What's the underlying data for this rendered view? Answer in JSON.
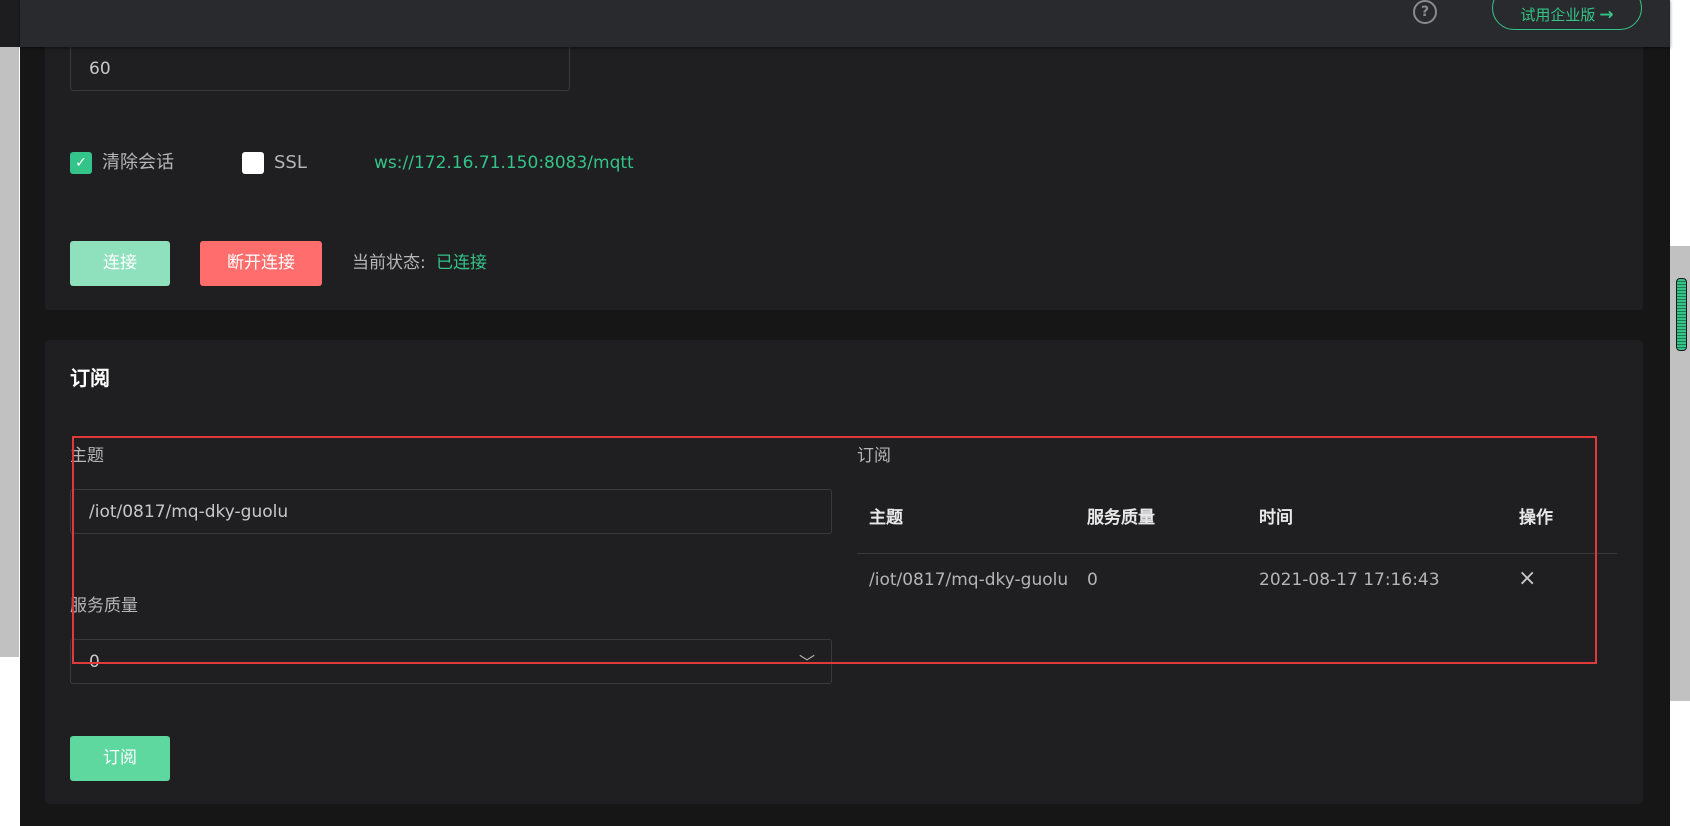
{
  "topbar": {
    "help_icon_glyph": "?",
    "trial_button_label": "试用企业版",
    "trial_button_arrow": "→"
  },
  "connection": {
    "keepalive_value": "60",
    "clean_session_label": "清除会话",
    "clean_session_checked": true,
    "ssl_label": "SSL",
    "ssl_checked": false,
    "url": "ws://172.16.71.150:8083/mqtt",
    "connect_label": "连接",
    "disconnect_label": "断开连接",
    "status_label": "当前状态:",
    "status_value": "已连接"
  },
  "subscribe": {
    "section_title": "订阅",
    "topic_label": "主题",
    "topic_value": "/iot/0817/mq-dky-guolu",
    "qos_label": "服务质量",
    "qos_value": "0",
    "subscribe_button_label": "订阅",
    "list_title": "订阅",
    "table_headers": [
      "主题",
      "服务质量",
      "时间",
      "操作"
    ],
    "rows": [
      {
        "topic": "/iot/0817/mq-dky-guolu",
        "qos": "0",
        "time": "2021-08-17 17:16:43",
        "action_icon": "close-icon"
      }
    ]
  },
  "colors": {
    "accent": "#34c388",
    "danger": "#ff6d6d",
    "highlight": "#e03a3a",
    "background": "#161616",
    "card": "#1f1f21"
  }
}
